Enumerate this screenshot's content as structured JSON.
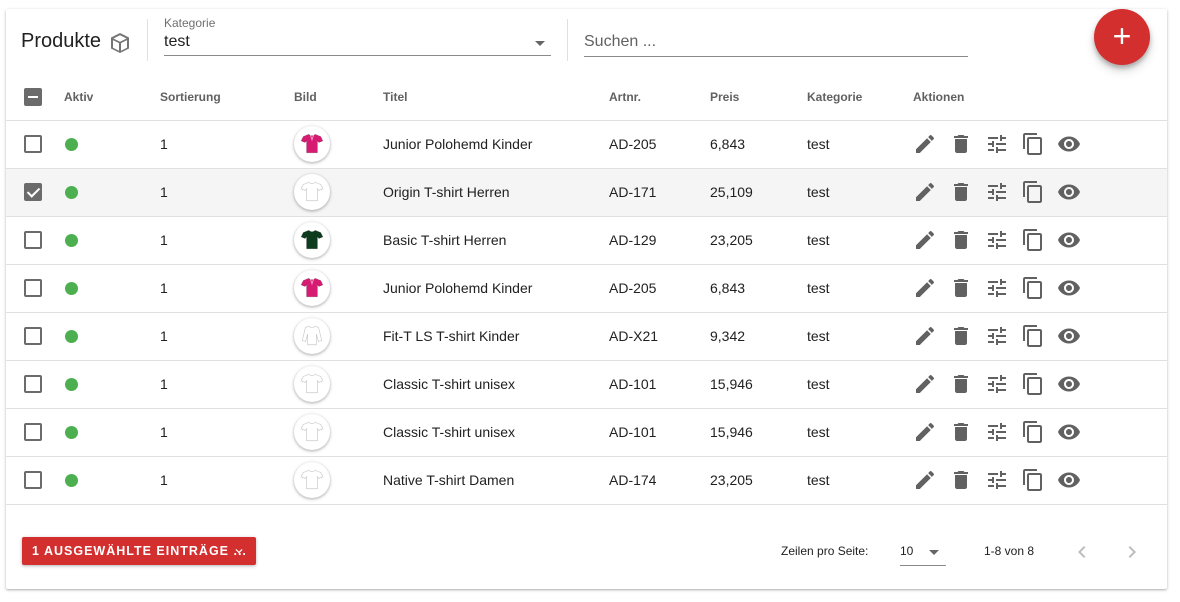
{
  "header": {
    "title": "Produkte",
    "title_icon": "package-icon",
    "category": {
      "label": "Kategorie",
      "value": "test"
    },
    "search": {
      "placeholder": "Suchen ...",
      "value": ""
    },
    "add_button": {
      "label": "+",
      "icon": "plus-icon",
      "color": "#d32f2f"
    }
  },
  "table": {
    "columns": [
      "Aktiv",
      "Sortierung",
      "Bild",
      "Titel",
      "Artnr.",
      "Preis",
      "Kategorie",
      "Aktionen"
    ],
    "rows": [
      {
        "selected": false,
        "active": true,
        "sort": "1",
        "shirt_color": "#d81b72",
        "shirt_type": "polo",
        "title": "Junior Polohemd Kinder",
        "artnr": "AD-205",
        "price": "6,843",
        "category": "test"
      },
      {
        "selected": true,
        "active": true,
        "sort": "1",
        "shirt_color": "#ffffff",
        "shirt_type": "tee",
        "title": "Origin T-shirt Herren",
        "artnr": "AD-171",
        "price": "25,109",
        "category": "test"
      },
      {
        "selected": false,
        "active": true,
        "sort": "1",
        "shirt_color": "#0d3b1e",
        "shirt_type": "tee",
        "title": "Basic T-shirt Herren",
        "artnr": "AD-129",
        "price": "23,205",
        "category": "test"
      },
      {
        "selected": false,
        "active": true,
        "sort": "1",
        "shirt_color": "#d81b72",
        "shirt_type": "polo",
        "title": "Junior Polohemd Kinder",
        "artnr": "AD-205",
        "price": "6,843",
        "category": "test"
      },
      {
        "selected": false,
        "active": true,
        "sort": "1",
        "shirt_color": "#ffffff",
        "shirt_type": "longsleeve",
        "title": "Fit-T LS T-shirt Kinder",
        "artnr": "AD-X21",
        "price": "9,342",
        "category": "test"
      },
      {
        "selected": false,
        "active": true,
        "sort": "1",
        "shirt_color": "#ffffff",
        "shirt_type": "tee",
        "title": "Classic T-shirt unisex",
        "artnr": "AD-101",
        "price": "15,946",
        "category": "test"
      },
      {
        "selected": false,
        "active": true,
        "sort": "1",
        "shirt_color": "#ffffff",
        "shirt_type": "tee",
        "title": "Classic T-shirt unisex",
        "artnr": "AD-101",
        "price": "15,946",
        "category": "test"
      },
      {
        "selected": false,
        "active": true,
        "sort": "1",
        "shirt_color": "#ffffff",
        "shirt_type": "tee",
        "title": "Native T-shirt Damen",
        "artnr": "AD-174",
        "price": "23,205",
        "category": "test"
      }
    ],
    "action_icons": [
      "pencil-icon",
      "trash-icon",
      "sliders-icon",
      "copy-icon",
      "eye-icon"
    ],
    "active_color": "#4caf50"
  },
  "footer": {
    "bulk_button": "1 AUSGEWÄHLTE EINTRÄGE ...",
    "rows_per_page_label": "Zeilen pro Seite:",
    "rows_per_page": "10",
    "range": "1-8 von 8"
  }
}
